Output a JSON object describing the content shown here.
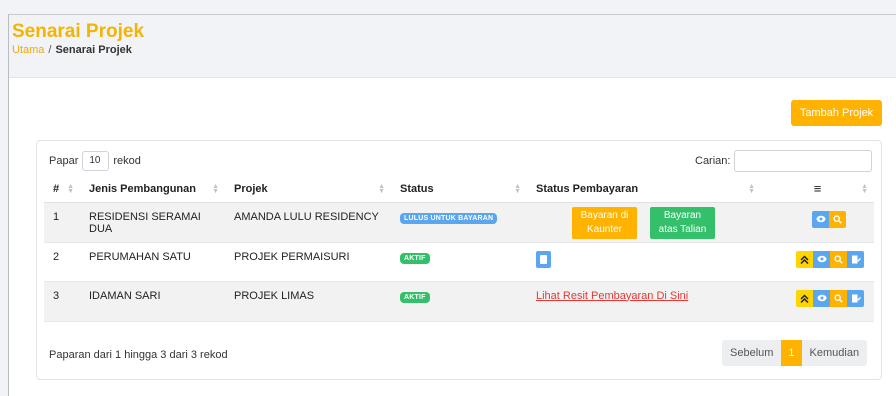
{
  "header": {
    "title": "Senarai Projek",
    "breadcrumb": {
      "home": "Utama",
      "separator": "/",
      "current": "Senarai Projek"
    }
  },
  "toolbar": {
    "add_label": "Tambah Projek"
  },
  "table_controls": {
    "length_prefix": "Papar",
    "length_value": "10",
    "length_suffix": "rekod",
    "search_label": "Carian:",
    "search_value": ""
  },
  "table": {
    "columns": [
      "#",
      "Jenis Pembangunan",
      "Projek",
      "Status",
      "Status Pembayaran",
      "≡"
    ],
    "rows": [
      {
        "no": "1",
        "jenis": "RESIDENSI SERAMAI DUA",
        "projek": "AMANDA LULU RESIDENCY",
        "status": "LULUS UNTUK BAYARAN",
        "payment": {
          "counter_label_1": "Bayaran di",
          "counter_label_2": "Kaunter",
          "online_label_1": "Bayaran",
          "online_label_2": "atas Talian"
        }
      },
      {
        "no": "2",
        "jenis": "PERUMAHAN SATU",
        "projek": "PROJEK PERMAISURI",
        "status": "AKTIF"
      },
      {
        "no": "3",
        "jenis": "IDAMAN SARI",
        "projek": "PROJEK LIMAS",
        "status": "AKTIF",
        "payment": {
          "link": "Lihat Resit Pembayaran Di Sini"
        }
      }
    ]
  },
  "footer": {
    "info": "Paparan dari 1 hingga 3 dari 3 rekod",
    "prev": "Sebelum",
    "page": "1",
    "next": "Kemudian"
  },
  "colors": {
    "accent": "#ffb300",
    "info": "#5aa7f0",
    "success": "#34c06b",
    "danger": "#e53935",
    "warning": "#ffd400"
  }
}
